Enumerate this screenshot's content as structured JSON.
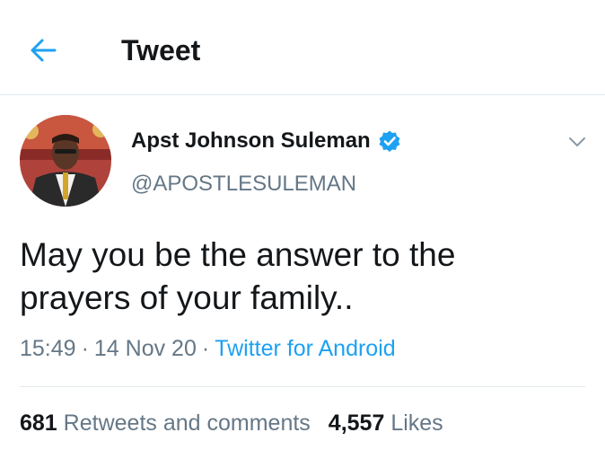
{
  "header": {
    "title": "Tweet",
    "back_icon": "arrow-left-icon"
  },
  "author": {
    "display_name": "Apst Johnson Suleman",
    "handle": "@APOSTLESULEMAN",
    "verified": true,
    "avatar": "profile-photo"
  },
  "tweet": {
    "text_line1": "May you be the answer to the",
    "text_line2": "prayers of your family..",
    "time": "15:49",
    "date": "14 Nov 20",
    "separator": "·",
    "source": "Twitter for Android"
  },
  "stats": {
    "retweets_count": "681",
    "retweets_label": "Retweets and comments",
    "likes_count": "4,557",
    "likes_label": "Likes"
  },
  "colors": {
    "accent": "#1da1f2",
    "secondary_text": "#657786",
    "primary_text": "#14171a",
    "divider": "#e1e8ed"
  }
}
